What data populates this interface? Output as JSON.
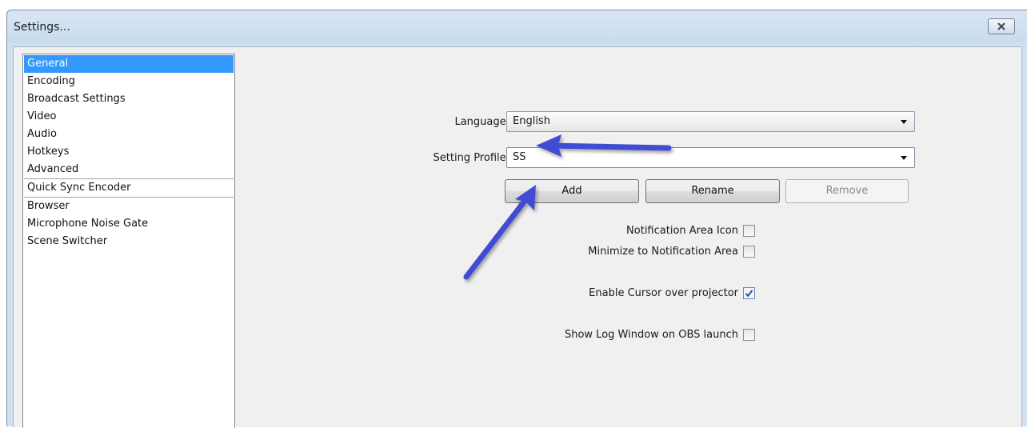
{
  "window": {
    "title": "Settings..."
  },
  "sidebar": {
    "items": [
      {
        "label": "General",
        "selected": true
      },
      {
        "label": "Encoding"
      },
      {
        "label": "Broadcast Settings"
      },
      {
        "label": "Video"
      },
      {
        "label": "Audio"
      },
      {
        "label": "Hotkeys"
      },
      {
        "label": "Advanced"
      }
    ],
    "plugins": [
      {
        "label": "Quick Sync Encoder"
      },
      {
        "label": "Browser"
      },
      {
        "label": "Microphone Noise Gate"
      },
      {
        "label": "Scene Switcher"
      }
    ]
  },
  "general": {
    "language_label": "Language:",
    "language_value": "English",
    "profile_label": "Setting Profile:",
    "profile_value": "SS",
    "add_label": "Add",
    "rename_label": "Rename",
    "remove_label": "Remove",
    "notification_icon_label": "Notification Area Icon",
    "notification_icon_checked": false,
    "minimize_label": "Minimize to Notification Area",
    "minimize_checked": false,
    "cursor_label": "Enable Cursor over projector",
    "cursor_checked": true,
    "log_label": "Show Log Window on OBS launch",
    "log_checked": false
  },
  "colors": {
    "selection": "#3399ff",
    "annotation_arrow": "#3f4ed3"
  },
  "icons": {
    "close": "close-x-icon",
    "dropdown": "dropdown-arrow-icon",
    "check": "checkmark-icon"
  }
}
